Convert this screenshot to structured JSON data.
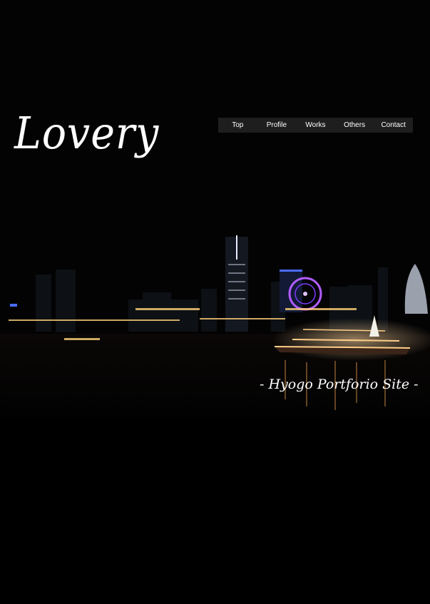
{
  "site": {
    "logo": "Lovery",
    "tagline": "- Hyogo Portforio Site -"
  },
  "nav": {
    "items": [
      {
        "label": "Top"
      },
      {
        "label": "Profile"
      },
      {
        "label": "Works"
      },
      {
        "label": "Others"
      },
      {
        "label": "Contact"
      }
    ]
  },
  "hero": {
    "image": "night-harbor-skyline",
    "colors": {
      "background": "#000000",
      "nav_bg": "#1e1e1e",
      "text": "#ffffff",
      "ferris_wheel": "#b05cff"
    }
  }
}
